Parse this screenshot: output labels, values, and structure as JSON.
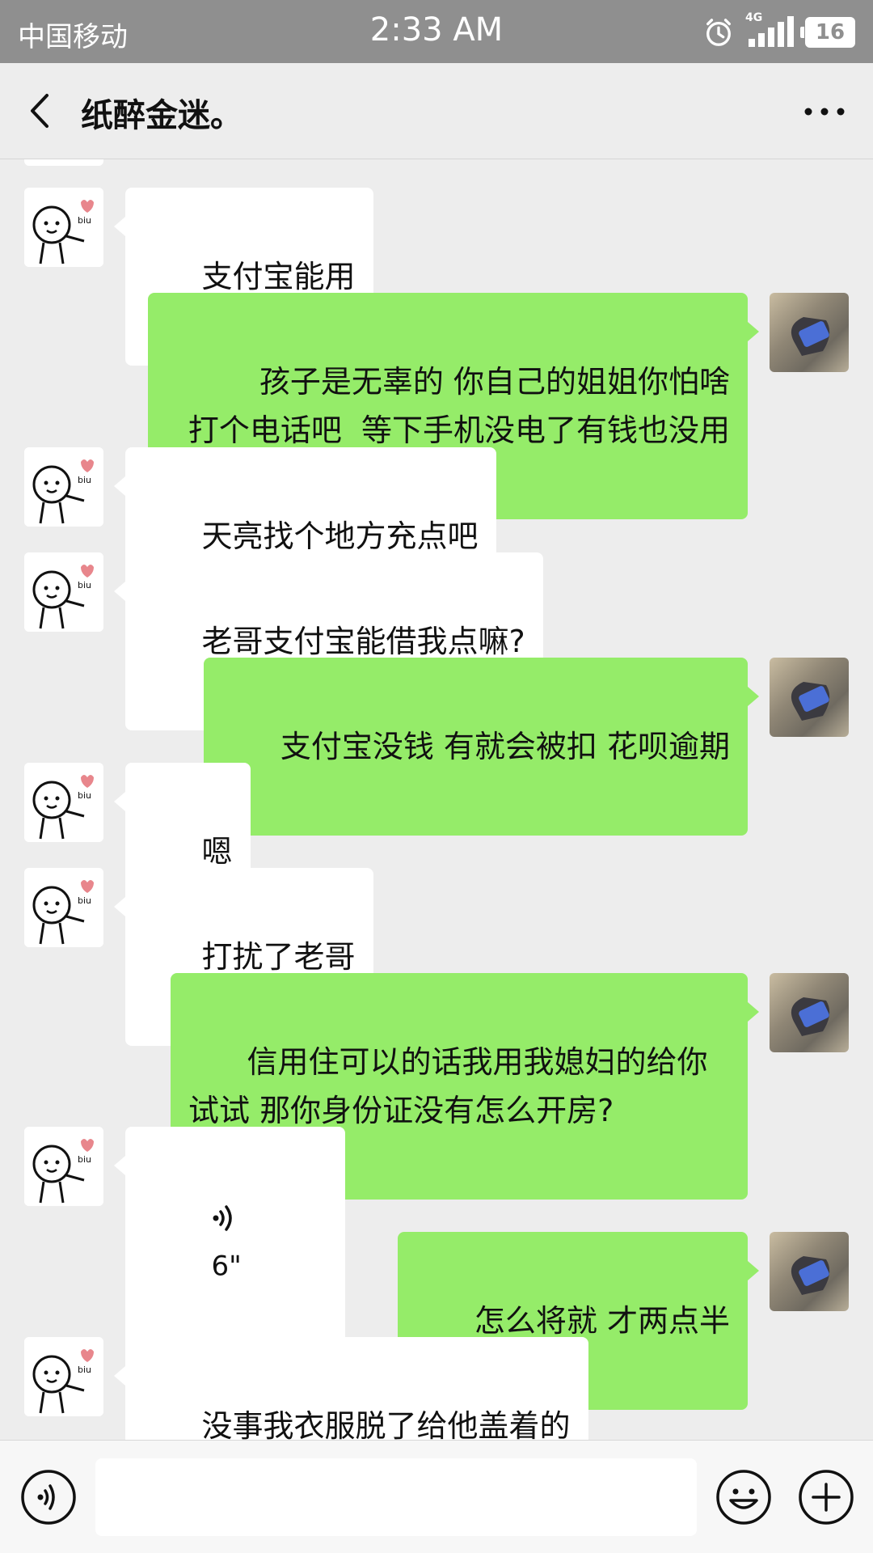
{
  "status_bar": {
    "carrier": "中国移动",
    "time": "2:33 AM",
    "network": "4G",
    "battery": "16"
  },
  "header": {
    "title": "纸醉金迷。"
  },
  "messages": [
    {
      "sender": "other",
      "text": "支付宝能用"
    },
    {
      "sender": "me",
      "text": "孩子是无辜的 你自己的姐姐你怕啥 打个电话吧  等下手机没电了有钱也没用"
    },
    {
      "sender": "other",
      "text": "天亮找个地方充点吧"
    },
    {
      "sender": "other",
      "text": "老哥支付宝能借我点嘛?"
    },
    {
      "sender": "me",
      "text": "支付宝没钱 有就会被扣 花呗逾期"
    },
    {
      "sender": "other",
      "text": "嗯"
    },
    {
      "sender": "other",
      "text": "打扰了老哥"
    },
    {
      "sender": "me",
      "text": "信用住可以的话我用我媳妇的给你试试 那你身份证没有怎么开房?"
    },
    {
      "sender": "other",
      "type": "voice",
      "duration": "6\""
    },
    {
      "sender": "me",
      "text": "怎么将就 才两点半"
    },
    {
      "sender": "other",
      "text": "没事我衣服脱了给他盖着的"
    }
  ],
  "input_bar": {
    "placeholder": ""
  },
  "colors": {
    "status_bar": "#8f8f8f",
    "background": "#ededed",
    "my_bubble": "#95ec69",
    "other_bubble": "#ffffff"
  }
}
